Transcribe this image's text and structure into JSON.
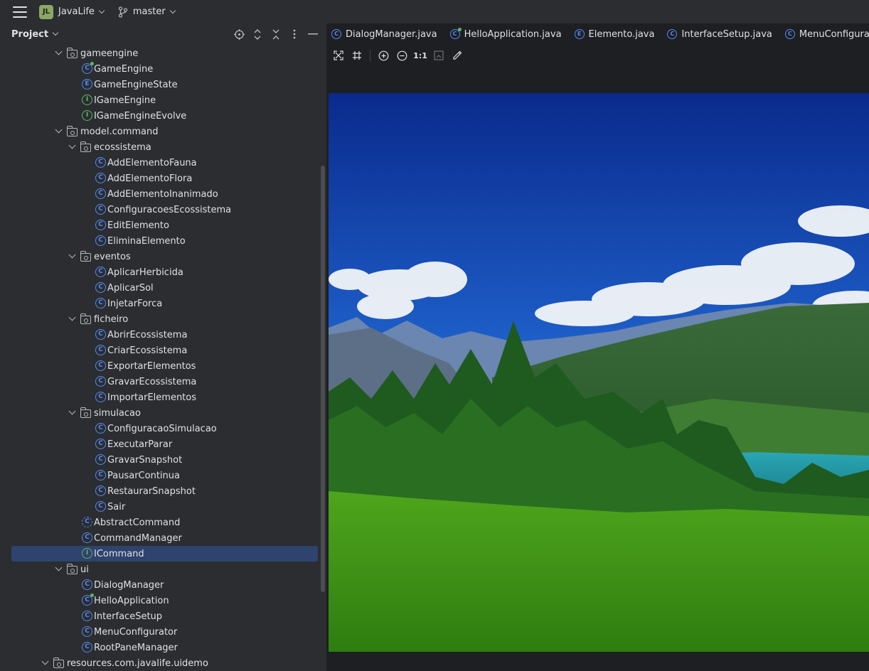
{
  "titlebar": {
    "project_badge": "JL",
    "project_name": "JavaLife",
    "branch": "master"
  },
  "panel": {
    "title": "Project"
  },
  "tree": [
    {
      "label": "gameengine",
      "type": "folder",
      "depth": 3,
      "expanded": true
    },
    {
      "label": "GameEngine",
      "type": "class-runnable",
      "depth": 4
    },
    {
      "label": "GameEngineState",
      "type": "enum",
      "depth": 4
    },
    {
      "label": "IGameEngine",
      "type": "interface",
      "depth": 4
    },
    {
      "label": "IGameEngineEvolve",
      "type": "interface",
      "depth": 4
    },
    {
      "label": "model.command",
      "type": "folder",
      "depth": 3,
      "expanded": true
    },
    {
      "label": "ecossistema",
      "type": "folder",
      "depth": 4,
      "expanded": true
    },
    {
      "label": "AddElementoFauna",
      "type": "class",
      "depth": 5
    },
    {
      "label": "AddElementoFlora",
      "type": "class",
      "depth": 5
    },
    {
      "label": "AddElementoInanimado",
      "type": "class",
      "depth": 5
    },
    {
      "label": "ConfiguracoesEcossistema",
      "type": "class",
      "depth": 5
    },
    {
      "label": "EditElemento",
      "type": "class",
      "depth": 5
    },
    {
      "label": "EliminaElemento",
      "type": "class",
      "depth": 5
    },
    {
      "label": "eventos",
      "type": "folder",
      "depth": 4,
      "expanded": true
    },
    {
      "label": "AplicarHerbicida",
      "type": "class",
      "depth": 5
    },
    {
      "label": "AplicarSol",
      "type": "class",
      "depth": 5
    },
    {
      "label": "InjetarForca",
      "type": "class",
      "depth": 5
    },
    {
      "label": "ficheiro",
      "type": "folder",
      "depth": 4,
      "expanded": true
    },
    {
      "label": "AbrirEcossistema",
      "type": "class",
      "depth": 5
    },
    {
      "label": "CriarEcossistema",
      "type": "class",
      "depth": 5
    },
    {
      "label": "ExportarElementos",
      "type": "class",
      "depth": 5
    },
    {
      "label": "GravarEcossistema",
      "type": "class",
      "depth": 5
    },
    {
      "label": "ImportarElementos",
      "type": "class",
      "depth": 5
    },
    {
      "label": "simulacao",
      "type": "folder",
      "depth": 4,
      "expanded": true
    },
    {
      "label": "ConfiguracaoSimulacao",
      "type": "class",
      "depth": 5
    },
    {
      "label": "ExecutarParar",
      "type": "class",
      "depth": 5
    },
    {
      "label": "GravarSnapshot",
      "type": "class",
      "depth": 5
    },
    {
      "label": "PausarContinua",
      "type": "class",
      "depth": 5
    },
    {
      "label": "RestaurarSnapshot",
      "type": "class",
      "depth": 5
    },
    {
      "label": "Sair",
      "type": "class",
      "depth": 5
    },
    {
      "label": "AbstractCommand",
      "type": "abstract",
      "depth": 4
    },
    {
      "label": "CommandManager",
      "type": "class",
      "depth": 4
    },
    {
      "label": "ICommand",
      "type": "interface",
      "depth": 4,
      "selected": true
    },
    {
      "label": "ui",
      "type": "folder",
      "depth": 3,
      "expanded": true
    },
    {
      "label": "DialogManager",
      "type": "class",
      "depth": 4
    },
    {
      "label": "HelloApplication",
      "type": "class-runnable",
      "depth": 4
    },
    {
      "label": "InterfaceSetup",
      "type": "class",
      "depth": 4
    },
    {
      "label": "MenuConfigurator",
      "type": "class",
      "depth": 4
    },
    {
      "label": "RootPaneManager",
      "type": "class",
      "depth": 4
    },
    {
      "label": "resources.com.javalife.uidemo",
      "type": "folder",
      "depth": 2,
      "expanded": true
    }
  ],
  "tabs": [
    {
      "label": "DialogManager.java",
      "icon": "C"
    },
    {
      "label": "HelloApplication.java",
      "icon": "C"
    },
    {
      "label": "Elemento.java",
      "icon": "E"
    },
    {
      "label": "InterfaceSetup.java",
      "icon": "C"
    },
    {
      "label": "MenuConfigurator.java",
      "icon": "C"
    }
  ],
  "image_toolbar": {
    "actual_size_label": "1:1"
  },
  "icons": {
    "class_glyph": "C",
    "enum_glyph": "E",
    "interface_glyph": "I"
  },
  "colors": {
    "class_blue": "#548af7",
    "interface_green": "#5fb865",
    "selection": "#2e436e",
    "panel_bg": "#2b2d30",
    "editor_bg": "#1e1f22"
  }
}
